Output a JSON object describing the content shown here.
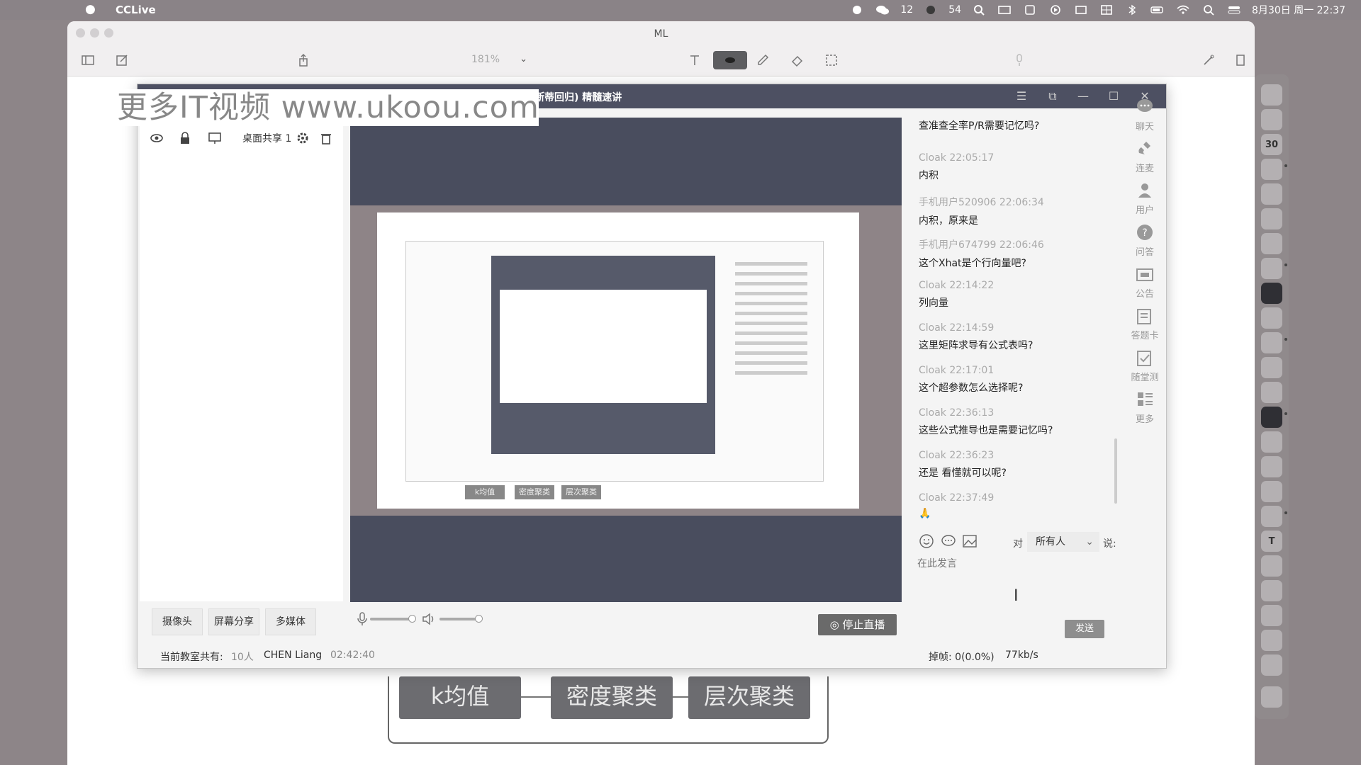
{
  "menubar": {
    "app_name": "CCLive",
    "wechat_count": "12",
    "notif_count": "54",
    "cal_date": "30",
    "datetime": "8月30日 周一  22:37"
  },
  "preview": {
    "title": "ML",
    "zoom": "181%"
  },
  "background_slide": {
    "boxes": [
      "k均值",
      "密度聚类",
      "层次聚类"
    ]
  },
  "watermark": "更多IT视频 www.ukoou.com",
  "cclive": {
    "title": "断蒂回归) 精髓速讲",
    "left_panel": {
      "desk_share_label": "桌面共享 1",
      "buttons": [
        "摄像头",
        "屏幕分享",
        "多媒体"
      ]
    },
    "stop_live_label": "停止直播",
    "nested_buttons": [
      "k均值",
      "密度聚类",
      "层次聚类"
    ],
    "chat": {
      "messages": [
        {
          "who": "",
          "text": "查准查全率P/R需要记忆吗?"
        },
        {
          "who": "Cloak 22:05:17",
          "text": "内积"
        },
        {
          "who": "手机用户520906 22:06:34",
          "text": "内积，原来是"
        },
        {
          "who": "手机用户674799 22:06:46",
          "text": "这个Xhat是个行向量吧?"
        },
        {
          "who": "Cloak 22:14:22",
          "text": "列向量"
        },
        {
          "who": "Cloak 22:14:59",
          "text": "这里矩阵求导有公式表吗?"
        },
        {
          "who": "Cloak 22:17:01",
          "text": "这个超参数怎么选择呢?"
        },
        {
          "who": "Cloak 22:36:13",
          "text": "这些公式推导也是需要记忆吗?"
        },
        {
          "who": "Cloak 22:36:23",
          "text": "还是 看懂就可以呢?"
        },
        {
          "who": "Cloak 22:37:49",
          "text": "🙏"
        }
      ],
      "to_label": "对",
      "target": "所有人",
      "say_label": "说:",
      "placeholder": "在此发言",
      "send_label": "发送"
    },
    "right_nav": [
      "聊天",
      "连麦",
      "用户",
      "问答",
      "公告",
      "答题卡",
      "随堂测",
      "更多"
    ],
    "status": {
      "room_label": "当前教室共有:",
      "room_count": "10人",
      "user": "CHEN Liang",
      "elapsed": "02:42:40",
      "drop_frames": "掉帧: 0(0.0%)",
      "bitrate": "77kb/s"
    }
  }
}
